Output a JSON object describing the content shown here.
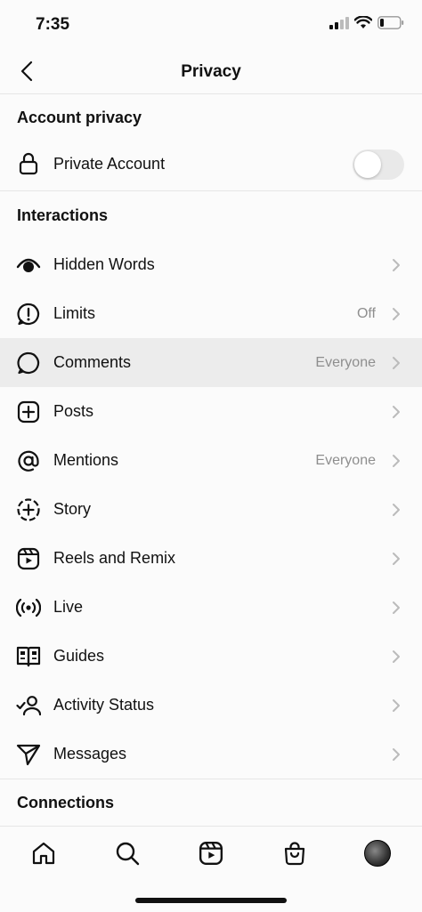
{
  "status_bar": {
    "time": "7:35"
  },
  "nav": {
    "title": "Privacy"
  },
  "sections": {
    "account_privacy": "Account privacy",
    "interactions": "Interactions",
    "connections": "Connections"
  },
  "account": {
    "private_account_label": "Private Account",
    "private_account_on": false
  },
  "interactions": [
    {
      "label": "Hidden Words",
      "value": ""
    },
    {
      "label": "Limits",
      "value": "Off"
    },
    {
      "label": "Comments",
      "value": "Everyone"
    },
    {
      "label": "Posts",
      "value": ""
    },
    {
      "label": "Mentions",
      "value": "Everyone"
    },
    {
      "label": "Story",
      "value": ""
    },
    {
      "label": "Reels and Remix",
      "value": ""
    },
    {
      "label": "Live",
      "value": ""
    },
    {
      "label": "Guides",
      "value": ""
    },
    {
      "label": "Activity Status",
      "value": ""
    },
    {
      "label": "Messages",
      "value": ""
    }
  ],
  "tabbar": {
    "items": [
      "home-icon",
      "search-icon",
      "reels-icon",
      "shop-icon",
      "profile-avatar"
    ]
  }
}
